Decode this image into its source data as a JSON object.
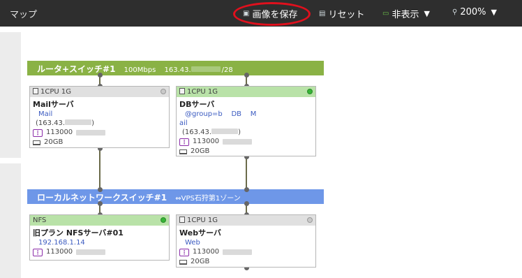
{
  "toolbar": {
    "title": "マップ",
    "save_image": "画像を保存",
    "reset": "リセット",
    "hide": "非表示",
    "zoom": "200%"
  },
  "switches": {
    "router": {
      "name": "ルータ+スイッチ#1",
      "bandwidth": "100Mbps",
      "ip_prefix": "163.43.",
      "ip_suffix": "/28"
    },
    "local": {
      "name": "ローカルネットワークスイッチ#1",
      "zone": "⇔VPS石狩第1ゾーン"
    }
  },
  "nodes": {
    "mail": {
      "plan": "1CPU 1G",
      "name": "Mailサーバ",
      "tag": "Mail",
      "ip": "(163.43.",
      "ip_end": ")",
      "disk_id": "113000",
      "disk_size": "20GB",
      "status": "off"
    },
    "db": {
      "plan": "1CPU 1G",
      "name": "DBサーバ",
      "tag_line1": "@group=b    DB    M",
      "tag_line2": "ail",
      "ip": "(163.43.",
      "ip_end": ")",
      "disk_id": "113000",
      "disk_size": "20GB",
      "status": "on"
    },
    "nfs": {
      "plan": "NFS",
      "name": "旧プラン NFSサーバ#01",
      "ip": "192.168.1.14",
      "disk_id": "113000",
      "status": "on"
    },
    "web": {
      "plan": "1CPU 1G",
      "name": "Webサーバ",
      "tag": "Web",
      "disk_id": "113000",
      "disk_size": "20GB",
      "status": "off"
    }
  }
}
